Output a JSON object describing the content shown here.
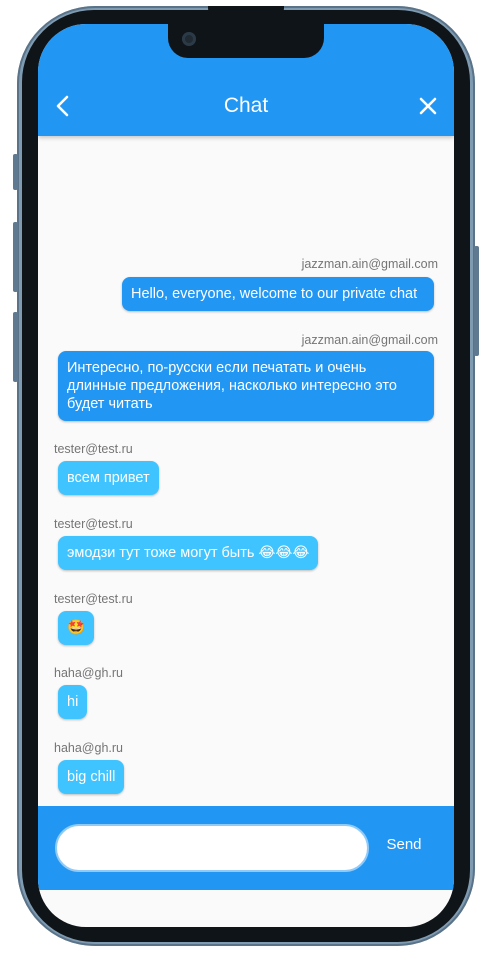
{
  "appbar": {
    "title": "Chat",
    "back_icon": "arrow-back-icon",
    "close_icon": "close-icon"
  },
  "messages": [
    {
      "sender": "jazzman.ain@gmail.com",
      "text": "Hello, everyone, welcome to our private chat",
      "mine": true
    },
    {
      "sender": "jazzman.ain@gmail.com",
      "text": "Интересно, по-русски если печатать и очень длинные предложения, насколько интересно это будет читать",
      "mine": true
    },
    {
      "sender": "tester@test.ru",
      "text": "всем привет",
      "mine": false
    },
    {
      "sender": "tester@test.ru",
      "text": "эмодзи тут тоже могут быть 😂😂😂",
      "mine": false
    },
    {
      "sender": "tester@test.ru",
      "text": "🤩",
      "mine": false
    },
    {
      "sender": "haha@gh.ru",
      "text": "hi",
      "mine": false
    },
    {
      "sender": "haha@gh.ru",
      "text": "big chill",
      "mine": false
    }
  ],
  "composer": {
    "input_value": "",
    "input_placeholder": "",
    "send_label": "Send"
  },
  "colors": {
    "primary": "#2196f3",
    "other_bubble": "#40c4ff",
    "background": "#fafafa"
  }
}
